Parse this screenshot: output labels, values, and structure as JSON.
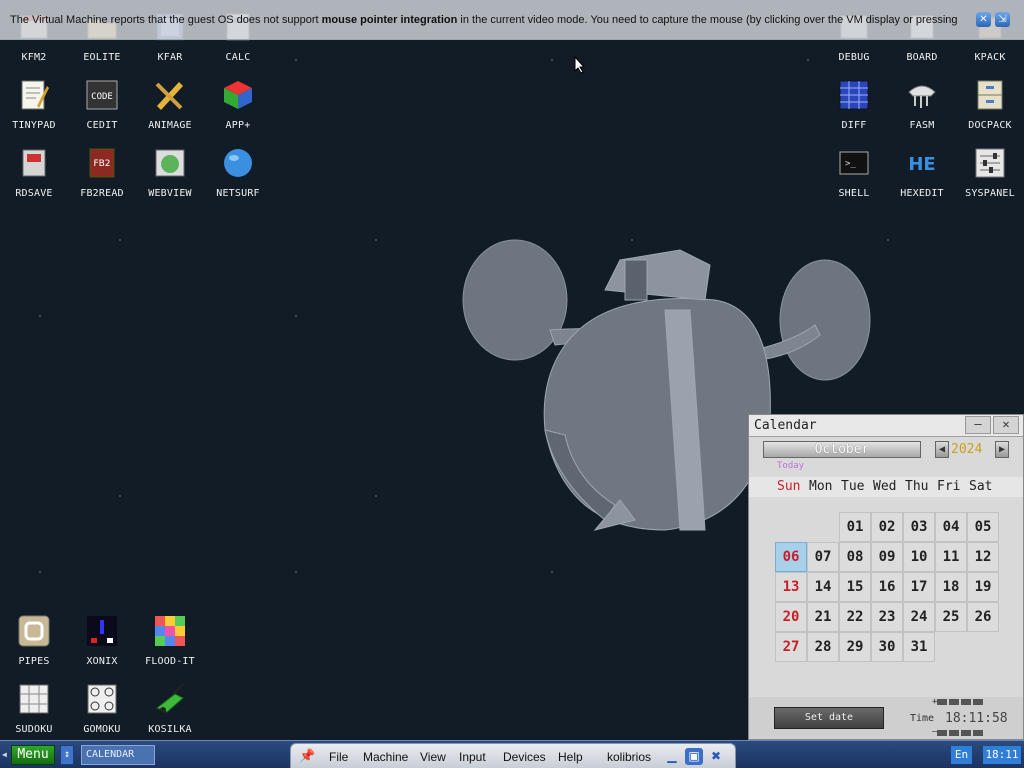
{
  "notification": {
    "text_before": "The Virtual Machine reports that the guest OS does not support ",
    "text_bold": "mouse pointer integration",
    "text_after": " in the current video mode. You need to capture the mouse (by clicking over the VM display or pressing"
  },
  "desktop_icons": [
    {
      "label": "KFM2"
    },
    {
      "label": "EOLITE"
    },
    {
      "label": "KFAR"
    },
    {
      "label": "CALC"
    },
    {
      "label": "TINYPAD"
    },
    {
      "label": "CEDIT"
    },
    {
      "label": "ANIMAGE"
    },
    {
      "label": "APP+"
    },
    {
      "label": "RDSAVE"
    },
    {
      "label": "FB2READ"
    },
    {
      "label": "WEBVIEW"
    },
    {
      "label": "NETSURF"
    },
    {
      "label": "DEBUG"
    },
    {
      "label": "BOARD"
    },
    {
      "label": "KPACK"
    },
    {
      "label": "DIFF"
    },
    {
      "label": "FASM"
    },
    {
      "label": "DOCPACK"
    },
    {
      "label": "SHELL"
    },
    {
      "label": "HEXEDIT"
    },
    {
      "label": "SYSPANEL"
    },
    {
      "label": "PIPES"
    },
    {
      "label": "XONIX"
    },
    {
      "label": "FLOOD-IT"
    },
    {
      "label": "SUDOKU"
    },
    {
      "label": "GOMOKU"
    },
    {
      "label": "KOSILKA"
    }
  ],
  "icon_text": {
    "cedit": "CODE",
    "fb2read": "FB2",
    "hexedit": "HE",
    "shell": ">_"
  },
  "calendar": {
    "title": "Calendar",
    "minimize_symbol": "–",
    "close_symbol": "✕",
    "month": "October",
    "year": "2024",
    "prev_symbol": "◀",
    "next_symbol": "▶",
    "today_label": "Today",
    "weekdays": [
      "Sun",
      "Mon",
      "Tue",
      "Wed",
      "Thu",
      "Fri",
      "Sat"
    ],
    "days": [
      "01",
      "02",
      "03",
      "04",
      "05",
      "06",
      "07",
      "08",
      "09",
      "10",
      "11",
      "12",
      "13",
      "14",
      "15",
      "16",
      "17",
      "18",
      "19",
      "20",
      "21",
      "22",
      "23",
      "24",
      "25",
      "26",
      "27",
      "28",
      "29",
      "30",
      "31"
    ],
    "first_weekday_index": 2,
    "selected_day": "06",
    "set_date_label": "Set date",
    "time_label": "Time",
    "time_value": "18:11:58",
    "plus_symbol": "+",
    "minus_symbol": "–"
  },
  "taskbar": {
    "menu_label": "Menu",
    "task_calendar": "CALENDAR",
    "switch_symbol": "↕",
    "language": "En",
    "clock": "18:11"
  },
  "vbox_toolbar": {
    "menus": [
      "File",
      "Machine",
      "View",
      "Input",
      "Devices",
      "Help"
    ],
    "vm_name": "kolibrios"
  },
  "colors": {
    "desktop_bg": "#121c27",
    "taskbar_bg": "#1a3362",
    "menu_green": "#2ea82a",
    "sunday_red": "#c8202a",
    "today_highlight": "#a8d0ea",
    "year_gold": "#c9a21a"
  }
}
